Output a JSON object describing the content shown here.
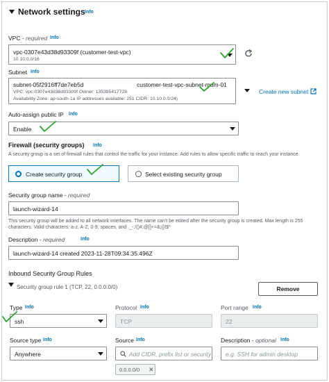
{
  "network": {
    "title": "Network settings",
    "info": "Info"
  },
  "vpc": {
    "label": "VPC - ",
    "required": "required",
    "info": "Info",
    "value": "vpc-0307e43d38d93309f (customer-test-vpc)",
    "cidr": "10.10.0.0/16"
  },
  "subnet": {
    "label": "Subnet",
    "info": "Info",
    "id": "subnet-05f2916ff7de7eb5d",
    "name": "customer-test-vpc-subnet-mum-01",
    "line2": "VPC: vpc-0307e43d38d93309f    Owner: 135385417728",
    "line3": "Availability Zone: ap-south-1a    IP addresses available: 251    CIDR: 10.10.0.0/24)",
    "create_link": "Create new subnet"
  },
  "auto_ip": {
    "label": "Auto-assign public IP",
    "info": "Info",
    "value": "Enable"
  },
  "firewall": {
    "title": "Firewall (security groups)",
    "info": "Info",
    "description": "A security group is a set of firewall rules that control the traffic for your instance. Add rules to allow specific traffic to reach your instance.",
    "option_create": "Create security group",
    "option_existing": "Select existing security group"
  },
  "sg_name": {
    "label": "Security group name - ",
    "required": "required",
    "value": "launch-wizard-14",
    "note": "This security group will be added to all network interfaces. The name can't be edited after the security group is created. Max length is 255 characters. Valid characters: a-z, A-Z, 0-9, spaces, and ._-:/()#,@[]+=&;{}!$*"
  },
  "description_field": {
    "label": "Description - ",
    "required": "required",
    "info": "Info",
    "value": "launch-wizard-14 created 2023-11-28T09:34:35.496Z"
  },
  "inbound": {
    "title": "Inbound Security Group Rules",
    "rule_label": "Security group rule 1 (TCP, 22, 0.0.0.0/0)",
    "remove_button": "Remove",
    "type_label": "Type",
    "type_info": "Info",
    "type_value": "ssh",
    "protocol_label": "Protocol",
    "protocol_info": "Info",
    "protocol_value": "TCP",
    "port_label": "Port range",
    "port_info": "Info",
    "port_value": "22",
    "source_type_label": "Source type",
    "source_type_info": "Info",
    "source_type_value": "Anywhere",
    "source_label": "Source",
    "source_info": "Info",
    "source_placeholder": "Add CIDR, prefix list or security",
    "source_token": "0.0.0.0/0",
    "desc_label": "Description - ",
    "desc_optional": "optional",
    "desc_info": "Info",
    "desc_placeholder": "e.g. SSH for admin desktop"
  },
  "colors": {
    "link": "#0073bb",
    "check": "#2aa52a",
    "selected_bg": "#f1faff"
  }
}
